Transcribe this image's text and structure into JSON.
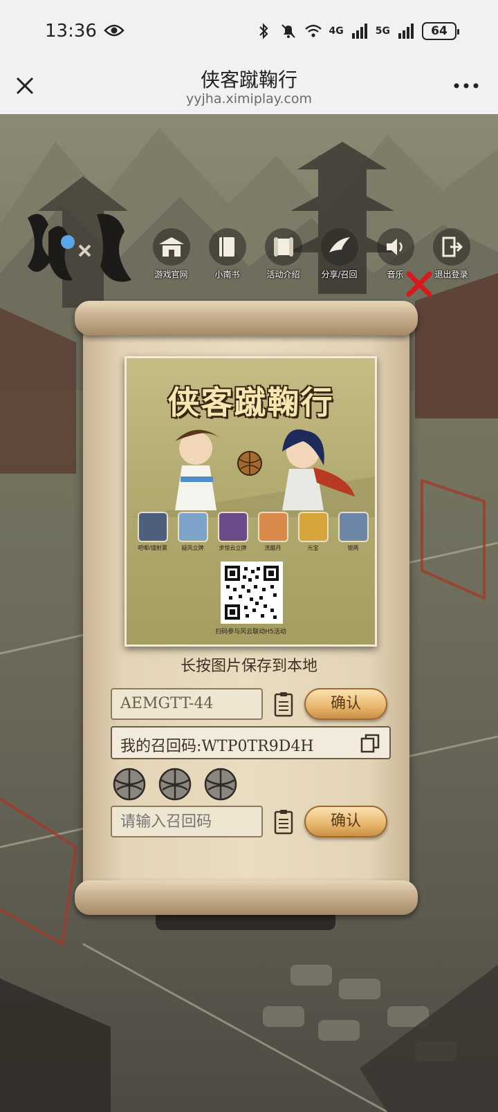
{
  "status_bar": {
    "time": "13:36",
    "network_4g": "4G",
    "network_5g": "5G",
    "battery": "64"
  },
  "browser": {
    "title": "侠客蹴鞠行",
    "url": "yyjha.ximiplay.com"
  },
  "menu": {
    "items": [
      {
        "label": "游戏官网",
        "icon": "building-icon"
      },
      {
        "label": "小南书",
        "icon": "book-icon"
      },
      {
        "label": "活动介绍",
        "icon": "scroll-icon"
      },
      {
        "label": "分享/召回",
        "icon": "bird-icon"
      },
      {
        "label": "音乐",
        "icon": "speaker-icon"
      },
      {
        "label": "退出登录",
        "icon": "exit-icon"
      }
    ]
  },
  "poster": {
    "title": "侠客蹴鞠行",
    "rewards": [
      {
        "label": "吧唧/镭射票"
      },
      {
        "label": "疑风立牌"
      },
      {
        "label": "步惊云立牌"
      },
      {
        "label": "洗髓丹"
      },
      {
        "label": "元宝"
      },
      {
        "label": "银两"
      }
    ],
    "qr_caption": "扫码参与风云联动H5活动"
  },
  "save_hint": "长按图片保存到本地",
  "form": {
    "code_value": "AEMGTT-44",
    "confirm_label": "确认",
    "recall_code_text": "我的召回码:WTP0TR9D4H",
    "recall_placeholder": "请输入召回码",
    "confirm_label_2": "确认",
    "ball_count": 3
  },
  "colors": {
    "accent_button": "#e8b66c",
    "paper": "#eadcc0",
    "ink": "#3c3227"
  }
}
